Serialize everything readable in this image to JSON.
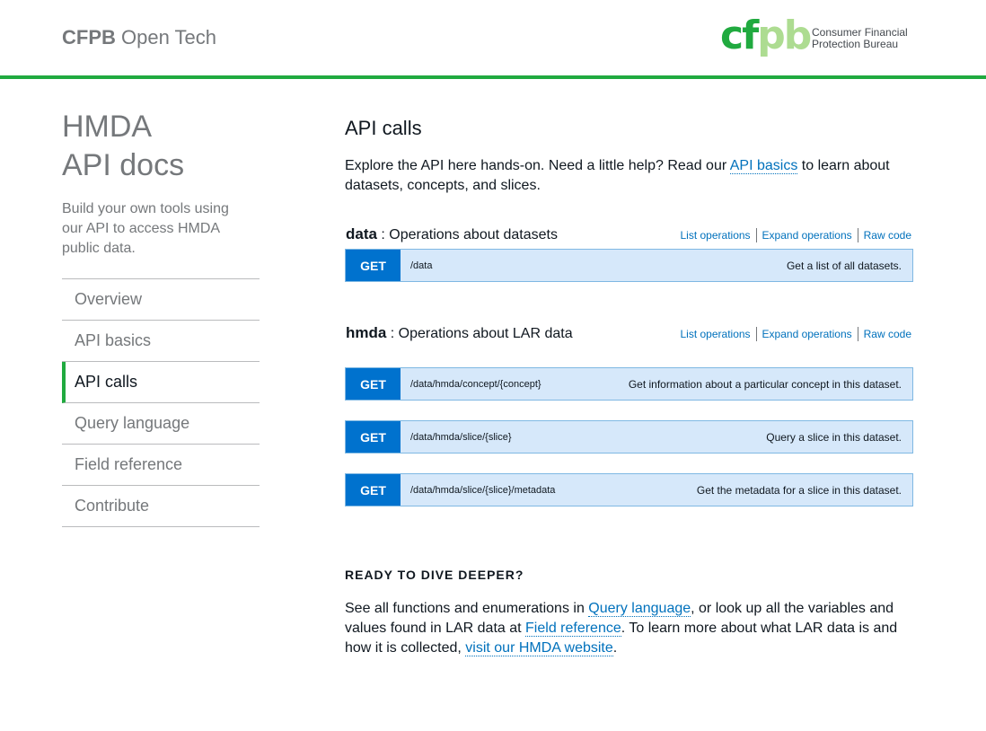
{
  "header": {
    "site_title_strong": "CFPB",
    "site_title_rest": "Open Tech",
    "logo_mark_a": "cf",
    "logo_mark_b": "pb",
    "logo_text_line1": "Consumer Financial",
    "logo_text_line2": "Protection Bureau",
    "accent_color": "#20aa3f"
  },
  "sidebar": {
    "title_line1": "HMDA",
    "title_line2": "API docs",
    "description": "Build your own tools using our API to access HMDA public data.",
    "items": [
      {
        "label": "Overview",
        "active": false
      },
      {
        "label": "API basics",
        "active": false
      },
      {
        "label": "API calls",
        "active": true
      },
      {
        "label": "Query language",
        "active": false
      },
      {
        "label": "Field reference",
        "active": false
      },
      {
        "label": "Contribute",
        "active": false
      }
    ]
  },
  "main": {
    "title": "API calls",
    "intro_before": "Explore the API here hands-on. Need a little help? Read our ",
    "intro_link": "API basics",
    "intro_after": " to learn about datasets, concepts, and slices.",
    "resources": [
      {
        "name": "data",
        "description": " : Operations about datasets",
        "ops_labels": [
          "List operations",
          "Expand operations",
          "Raw code"
        ],
        "operations": [
          {
            "method": "GET",
            "path": "/data",
            "summary": "Get a list of all datasets."
          }
        ]
      },
      {
        "name": "hmda",
        "description": " : Operations about LAR data",
        "ops_labels": [
          "List operations",
          "Expand operations",
          "Raw code"
        ],
        "operations": [
          {
            "method": "GET",
            "path": "/data/hmda/concept/{concept}",
            "summary": "Get information about a particular concept in this dataset."
          },
          {
            "method": "GET",
            "path": "/data/hmda/slice/{slice}",
            "summary": "Query a slice in this dataset."
          },
          {
            "method": "GET",
            "path": "/data/hmda/slice/{slice}/metadata",
            "summary": "Get the metadata for a slice in this dataset."
          }
        ]
      }
    ],
    "deeper": {
      "heading": "READY TO DIVE DEEPER?",
      "t1": "See all functions and enumerations in ",
      "l1": "Query language",
      "t2": ", or look up all the variables and values found in LAR data at ",
      "l2": "Field reference",
      "t3": ". To learn more about what LAR data is and how it is collected, ",
      "l3": "visit our HMDA website",
      "t4": "."
    }
  }
}
